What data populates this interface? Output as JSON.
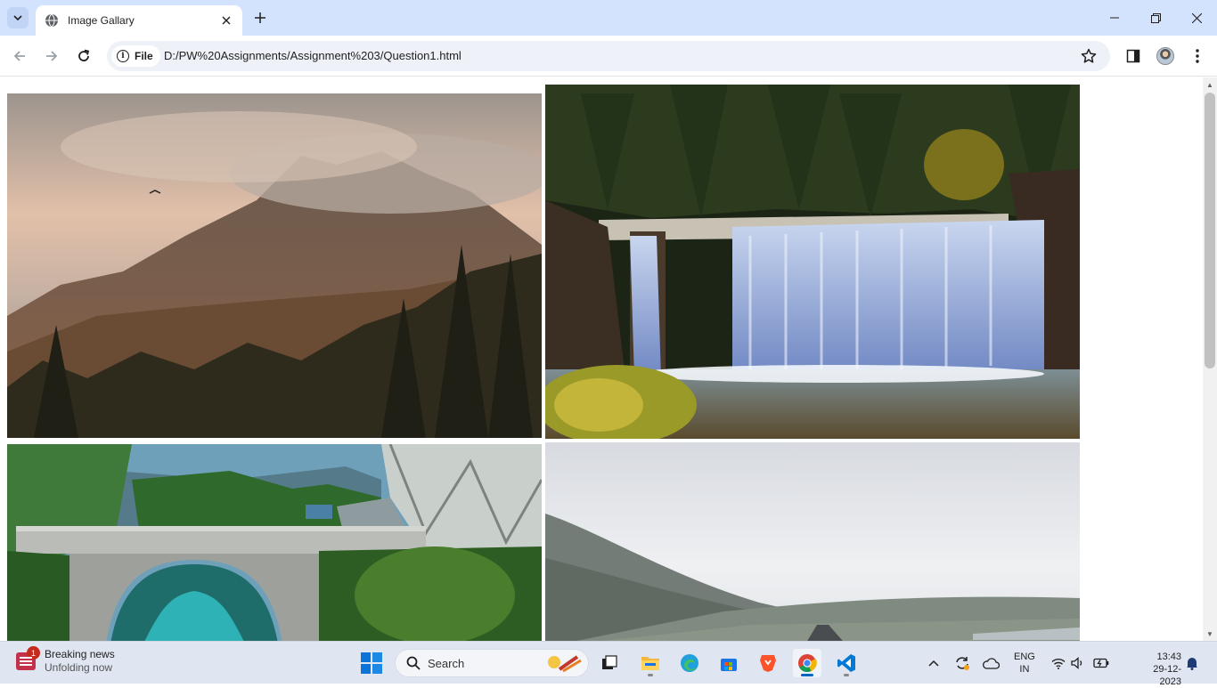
{
  "browser": {
    "tab": {
      "title": "Image Gallary",
      "icon": "globe-icon"
    },
    "omnibox": {
      "chip_label": "File",
      "url": "D:/PW%20Assignments/Assignment%203/Question1.html"
    }
  },
  "gallery": {
    "images": [
      {
        "subject": "mountain-forest-fog"
      },
      {
        "subject": "waterfall"
      },
      {
        "subject": "stone-bridge-river"
      },
      {
        "subject": "misty-valley-road"
      }
    ]
  },
  "taskbar": {
    "news": {
      "title": "Breaking news",
      "subtitle": "Unfolding now",
      "badge": "1"
    },
    "search_label": "Search",
    "language": {
      "line1": "ENG",
      "line2": "IN"
    },
    "clock": {
      "time": "13:43",
      "date": "29-12-2023"
    }
  },
  "colors": {
    "tabstrip": "#d3e3fd",
    "accent": "#0067c0",
    "taskbar": "#dfe6f1"
  }
}
